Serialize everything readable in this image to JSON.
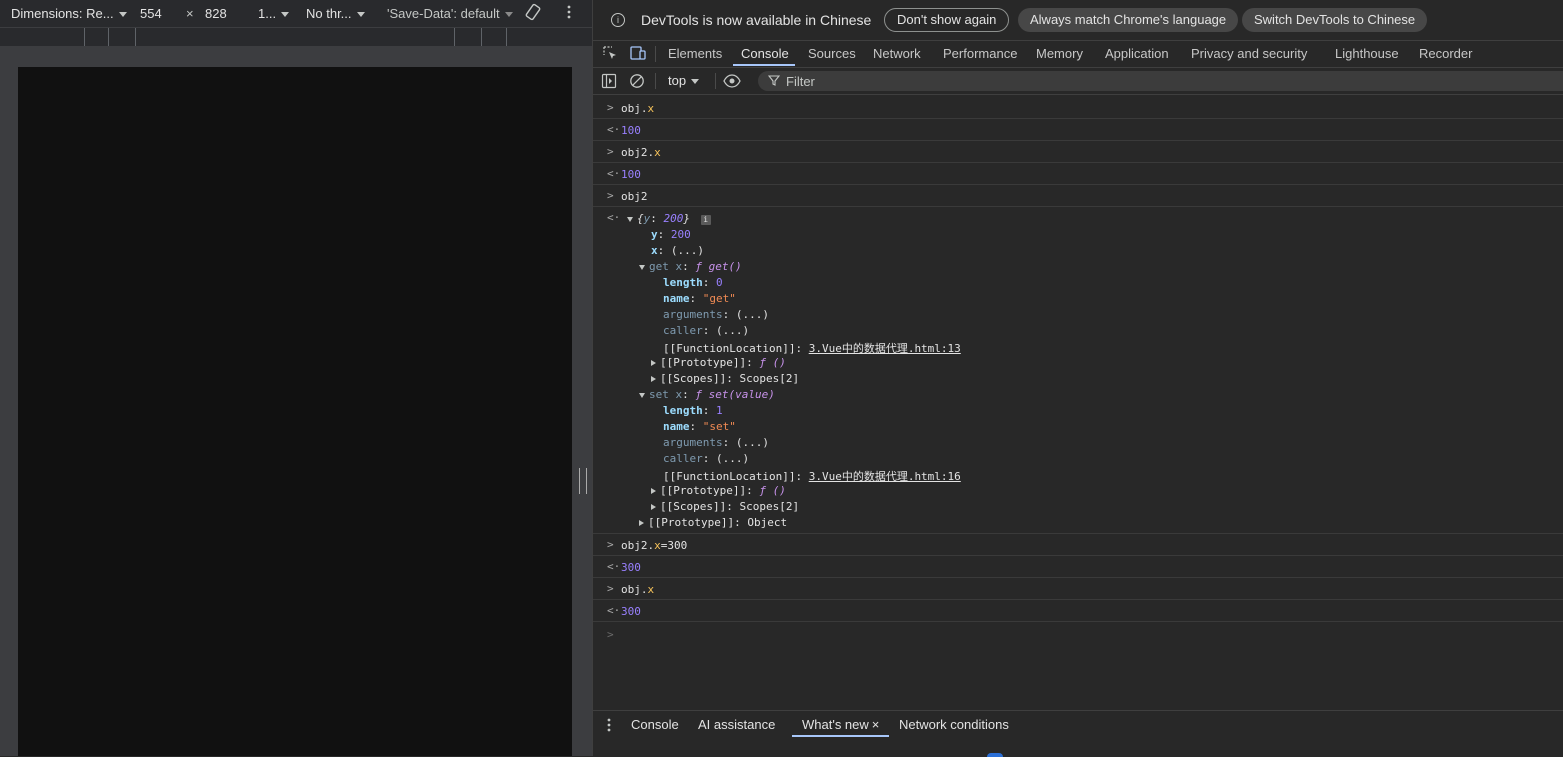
{
  "device_toolbar": {
    "dimensions": "Dimensions: Re...",
    "width": "554",
    "times": "×",
    "height": "828",
    "zoom": "1...",
    "throttle": "No thr...",
    "save_data": "'Save-Data': default"
  },
  "infobar": {
    "message": "DevTools is now available in Chinese",
    "btn_dont_show": "Don't show again",
    "btn_match": "Always match Chrome's language",
    "btn_switch": "Switch DevTools to Chinese"
  },
  "tabs": [
    "Elements",
    "Console",
    "Sources",
    "Network",
    "Performance",
    "Memory",
    "Application",
    "Privacy and security",
    "Lighthouse",
    "Recorder"
  ],
  "console_bar": {
    "context": "top",
    "filter_placeholder": "Filter"
  },
  "log": {
    "r1": {
      "obj": "obj.",
      "prop": "x"
    },
    "r2": "100",
    "r3": {
      "obj": "obj2.",
      "prop": "x"
    },
    "r4": "100",
    "r5": "obj2",
    "obj_preview": {
      "open": "{",
      "key": "y",
      "colon": ": ",
      "val": "200",
      "close": "}"
    },
    "y_key": "y",
    "y_val": "200",
    "x_key": "x",
    "x_val": "(...)",
    "get_label": "get x",
    "get_fn": "ƒ get()",
    "get_length_key": "length",
    "get_length_val": "0",
    "get_name_key": "name",
    "get_name_val": "\"get\"",
    "get_args": "arguments",
    "get_args_val": "(...)",
    "get_caller": "caller",
    "get_caller_val": "(...)",
    "get_loc_key": "[[FunctionLocation]]",
    "get_loc_val": "3.Vue中的数据代理.html:13",
    "get_proto_key": "[[Prototype]]",
    "get_proto_val": "ƒ ()",
    "get_scopes_key": "[[Scopes]]",
    "get_scopes_val": "Scopes[2]",
    "set_label": "set x",
    "set_fn": "ƒ set(value)",
    "set_length_key": "length",
    "set_length_val": "1",
    "set_name_key": "name",
    "set_name_val": "\"set\"",
    "set_args": "arguments",
    "set_args_val": "(...)",
    "set_caller": "caller",
    "set_caller_val": "(...)",
    "set_loc_key": "[[FunctionLocation]]",
    "set_loc_val": "3.Vue中的数据代理.html:16",
    "set_proto_key": "[[Prototype]]",
    "set_proto_val": "ƒ ()",
    "set_scopes_key": "[[Scopes]]",
    "set_scopes_val": "Scopes[2]",
    "obj_proto_key": "[[Prototype]]",
    "obj_proto_val": "Object",
    "r6": {
      "obj": "obj2.",
      "prop": "x",
      "rest": "=300"
    },
    "r7": "300",
    "r8": {
      "obj": "obj.",
      "prop": "x"
    },
    "r9": "300"
  },
  "drawer": {
    "tabs": [
      "Console",
      "AI assistance",
      "What's new",
      "Network conditions"
    ],
    "close": "×"
  },
  "colors": {
    "accent": "#a8c7fa",
    "number": "#9980ff",
    "string": "#f28b54",
    "key": "#9cdcfe"
  }
}
